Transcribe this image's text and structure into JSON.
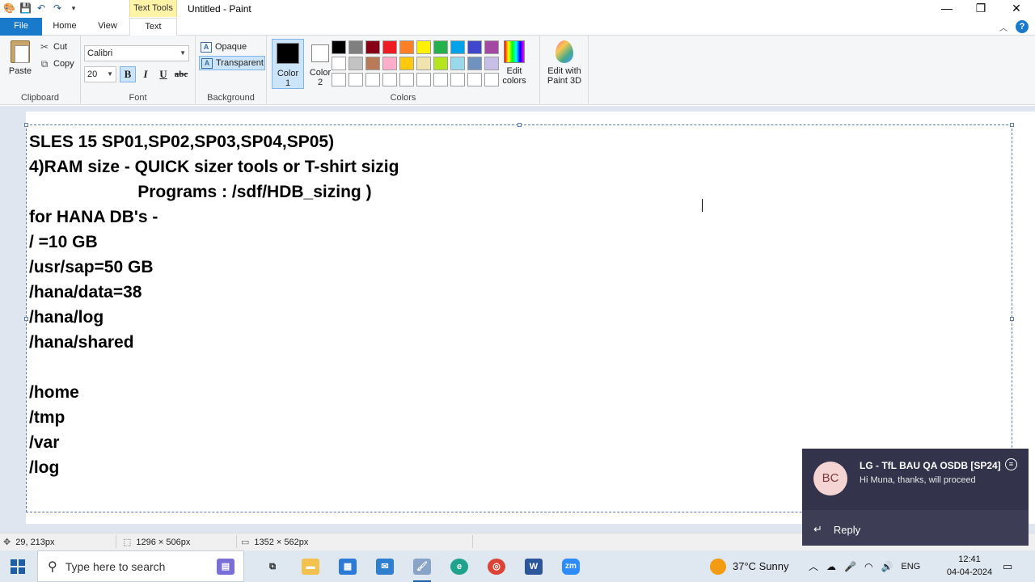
{
  "titlebar": {
    "context_tab": "Text Tools",
    "title": "Untitled - Paint"
  },
  "tabs": {
    "file": "File",
    "home": "Home",
    "view": "View",
    "text": "Text"
  },
  "clipboard": {
    "paste": "Paste",
    "cut": "Cut",
    "copy": "Copy",
    "label": "Clipboard"
  },
  "font": {
    "family": "Calibri",
    "size": "20",
    "bold": "B",
    "italic": "I",
    "underline": "U",
    "strike": "abc",
    "label": "Font"
  },
  "background": {
    "opaque": "Opaque",
    "transparent": "Transparent",
    "label": "Background"
  },
  "colors": {
    "color1_label": "Color\n1",
    "color2_label": "Color\n2",
    "color1": "#000000",
    "color2": "#ffffff",
    "palette": [
      "#000000",
      "#7f7f7f",
      "#880015",
      "#ed1c24",
      "#ff7f27",
      "#fff200",
      "#22b14c",
      "#00a2e8",
      "#3f48cc",
      "#a349a4",
      "#ffffff",
      "#c3c3c3",
      "#b97a57",
      "#ffaec9",
      "#ffc90e",
      "#efe4b0",
      "#b5e61d",
      "#99d9ea",
      "#7092be",
      "#c8bfe7",
      "#ffffff",
      "#ffffff",
      "#ffffff",
      "#ffffff",
      "#ffffff",
      "#ffffff",
      "#ffffff",
      "#ffffff",
      "#ffffff",
      "#ffffff"
    ],
    "edit_colors": "Edit\ncolors",
    "label": "Colors"
  },
  "paint3d": {
    "label": "Edit with\nPaint 3D"
  },
  "canvas_text": [
    "SLES 15 SP01,SP02,SP03,SP04,SP05)",
    "4)RAM size - QUICK sizer tools or T-shirt sizig",
    "                       Programs : /sdf/HDB_sizing )",
    "for HANA DB's -",
    "/ =10 GB",
    "/usr/sap=50 GB",
    "/hana/data=38",
    "/hana/log",
    "/hana/shared",
    "",
    "/home",
    "/tmp",
    "/var",
    "/log"
  ],
  "status": {
    "cursor_pos": "29, 213px",
    "selection_size": "1296 × 506px",
    "image_size": "1352 × 562px"
  },
  "toast": {
    "avatar_initials": "BC",
    "title": "LG - TfL BAU QA OSDB [SP24]",
    "message": "Hi Muna, thanks, will proceed",
    "reply": "Reply"
  },
  "taskbar": {
    "search_placeholder": "Type here to search",
    "weather": "37°C  Sunny",
    "language": "ENG",
    "time": "12:41",
    "date": "04-04-2024"
  }
}
